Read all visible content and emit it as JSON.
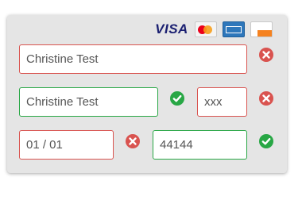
{
  "card_logos": [
    {
      "name": "visa",
      "text": "VISA"
    },
    {
      "name": "mastercard",
      "text": "MasterCard"
    },
    {
      "name": "american-express",
      "text": "AMERICAN EXPRESS"
    },
    {
      "name": "discover",
      "text": "DISCOVER"
    }
  ],
  "form": {
    "full_name": {
      "value": "Christine Test",
      "status": "invalid"
    },
    "card_name": {
      "value": "Christine Test",
      "status": "valid"
    },
    "cvv": {
      "value": "xxx",
      "status": "invalid"
    },
    "expiry": {
      "value": "01 / 01",
      "status": "invalid"
    },
    "zip": {
      "value": "44144",
      "status": "valid"
    }
  },
  "colors": {
    "invalid": "#d9534f",
    "valid": "#28a745",
    "card_background": "#e5e5e5"
  },
  "icons": {
    "invalid": "x-circle-icon",
    "valid": "check-circle-icon"
  }
}
